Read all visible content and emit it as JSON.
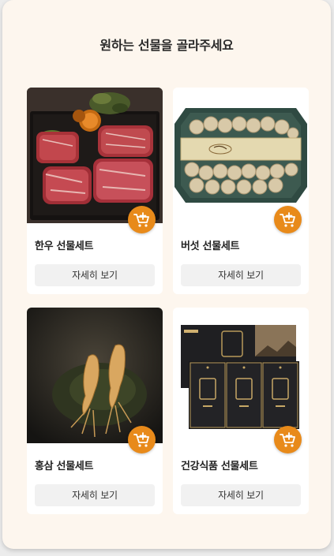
{
  "header": {
    "title": "원하는 선물을 골라주세요"
  },
  "products": [
    {
      "name": "한우 선물세트",
      "detail_label": "자세히 보기",
      "image": "hanwoo-beef-image",
      "cart_icon": "add-to-cart-icon"
    },
    {
      "name": "버섯 선물세트",
      "detail_label": "자세히 보기",
      "image": "mushroom-gift-box-image",
      "cart_icon": "add-to-cart-icon"
    },
    {
      "name": "홍삼 선물세트",
      "detail_label": "자세히 보기",
      "image": "red-ginseng-image",
      "cart_icon": "add-to-cart-icon"
    },
    {
      "name": "건강식품 선물세트",
      "detail_label": "자세히 보기",
      "image": "health-food-box-image",
      "cart_icon": "add-to-cart-icon"
    }
  ],
  "colors": {
    "background": "#fdf6ee",
    "accent": "#e88a1a",
    "button_bg": "#f1f1f1"
  }
}
